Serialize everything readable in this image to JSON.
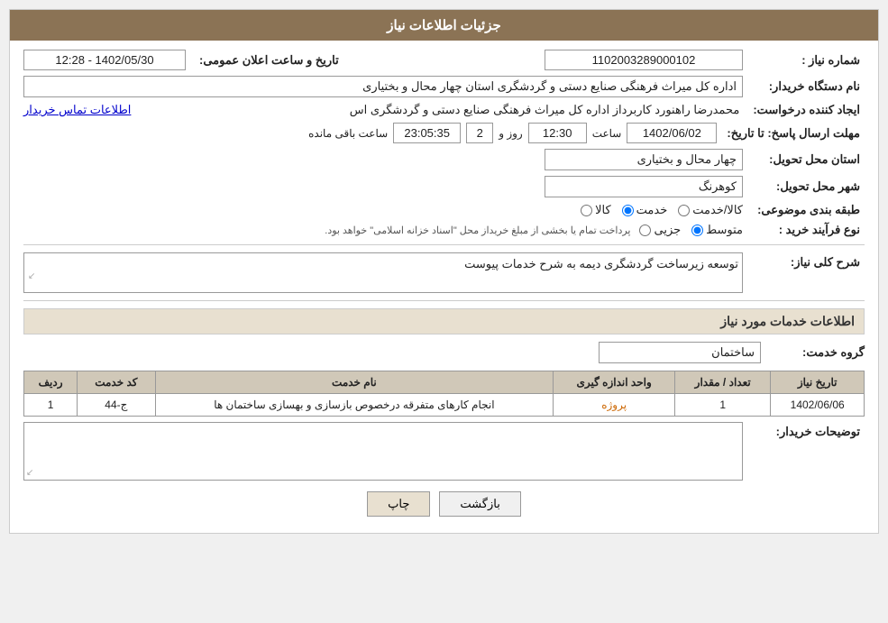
{
  "header": {
    "title": "جزئیات اطلاعات نیاز"
  },
  "fields": {
    "need_number_label": "شماره نیاز :",
    "need_number_value": "1102003289000102",
    "date_label": "تاریخ و ساعت اعلان عمومی:",
    "date_value": "1402/05/30 - 12:28",
    "buyer_org_label": "نام دستگاه خریدار:",
    "buyer_org_value": "اداره کل میراث فرهنگی  صنایع دستی و گردشگری استان چهار محال و بختیاری",
    "creator_label": "ایجاد کننده درخواست:",
    "creator_value": "محمدرضا راهنورد کاربرداز اداره کل میراث فرهنگی  صنایع دستی و گردشگری اس",
    "contact_info_link": "اطلاعات تماس خریدار",
    "reply_deadline_label": "مهلت ارسال پاسخ: تا تاریخ:",
    "reply_date_value": "1402/06/02",
    "reply_time_label": "ساعت",
    "reply_time_value": "12:30",
    "reply_days_label": "روز و",
    "reply_days_value": "2",
    "reply_remaining_label": "ساعت باقی مانده",
    "reply_remaining_value": "23:05:35",
    "province_label": "استان محل تحویل:",
    "province_value": "چهار محال و بختیاری",
    "city_label": "شهر محل تحویل:",
    "city_value": "کوهرنگ",
    "classification_label": "طبقه بندی موضوعی:",
    "radio_kala": "کالا",
    "radio_khedmat": "خدمت",
    "radio_kala_khedmat": "کالا/خدمت",
    "purchase_type_label": "نوع فرآیند خرید :",
    "radio_jazee": "جزیی",
    "radio_motavaset": "متوسط",
    "note_text": "پرداخت تمام یا بخشی از مبلغ خریداز محل \"اسناد خزانه اسلامی\" خواهد بود.",
    "need_desc_label": "شرح کلی نیاز:",
    "need_desc_value": "توسعه زیرساخت گردشگری دیمه به شرح خدمات پیوست",
    "services_section_label": "اطلاعات خدمات مورد نیاز",
    "service_group_label": "گروه خدمت:",
    "service_group_value": "ساختمان",
    "table_headers": {
      "row_num": "ردیف",
      "service_code": "کد خدمت",
      "service_name": "نام خدمت",
      "unit": "واحد اندازه گیری",
      "quantity": "تعداد / مقدار",
      "need_date": "تاریخ نیاز"
    },
    "table_rows": [
      {
        "row_num": "1",
        "service_code": "ج-44",
        "service_name": "انجام کارهای متفرقه درخصوص بازسازی و بهسازی ساختمان ها",
        "unit": "پروژه",
        "quantity": "1",
        "need_date": "1402/06/06"
      }
    ],
    "buyer_notes_label": "توضیحات خریدار:",
    "buyer_notes_value": ""
  },
  "buttons": {
    "print_label": "چاپ",
    "back_label": "بازگشت"
  }
}
